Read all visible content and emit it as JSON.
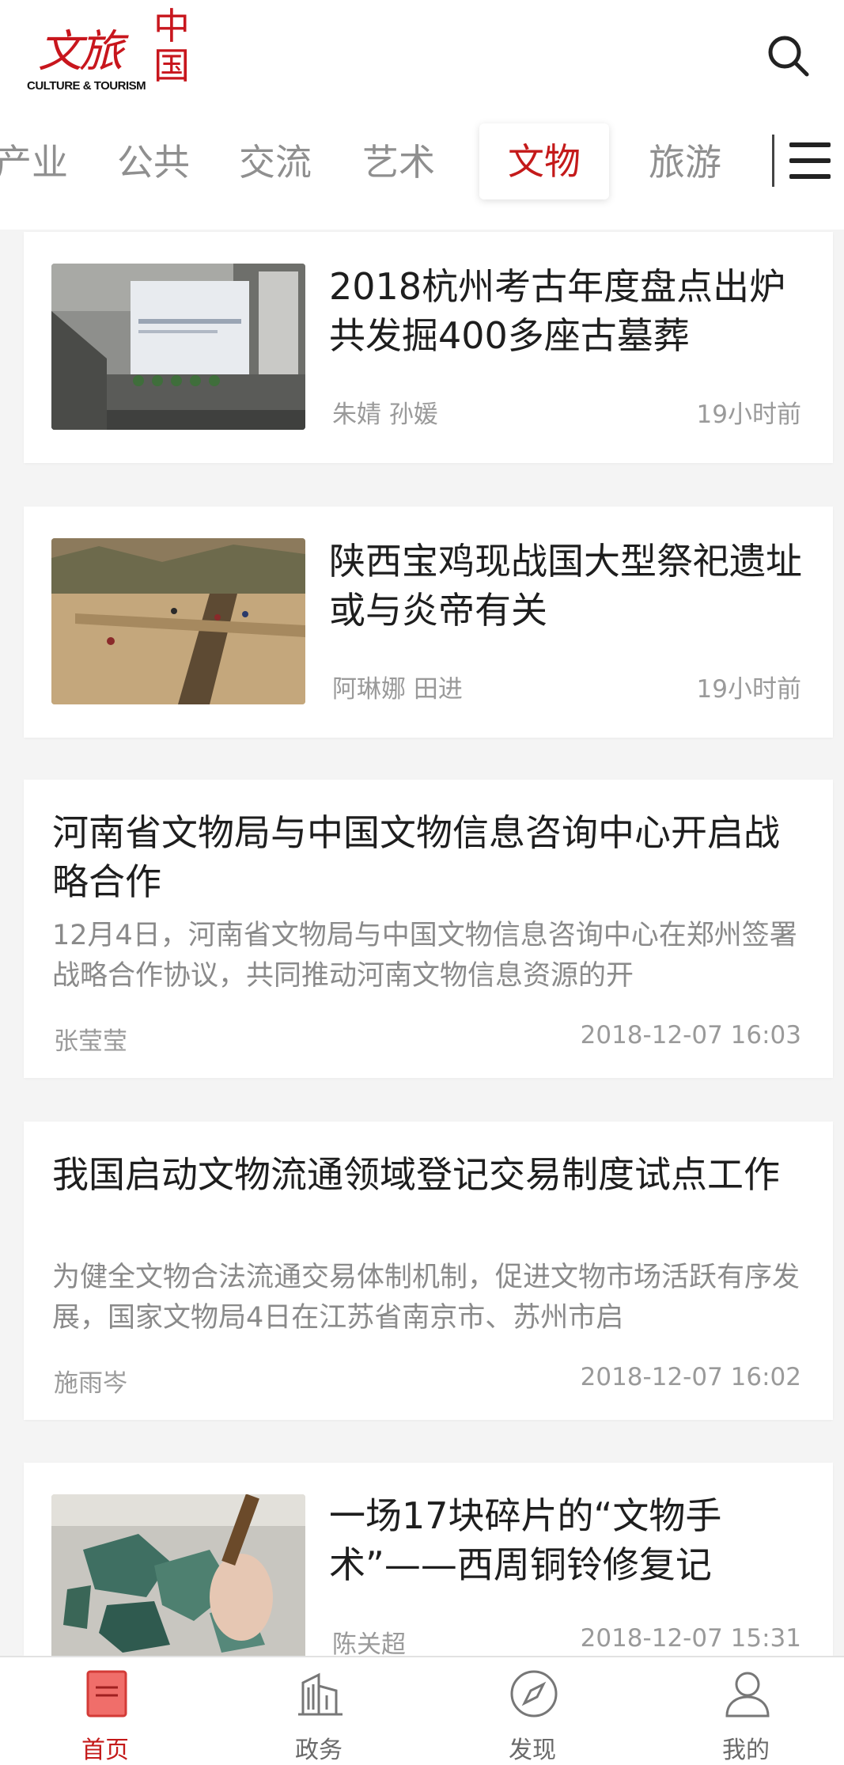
{
  "app": {
    "logo_cn": "文旅",
    "logo_cn_side": "中国",
    "logo_en": "CULTURE & TOURISM"
  },
  "tabs": [
    {
      "label": "产业"
    },
    {
      "label": "公共"
    },
    {
      "label": "交流"
    },
    {
      "label": "艺术"
    },
    {
      "label": "文物",
      "active": true
    },
    {
      "label": "旅游"
    }
  ],
  "articles": [
    {
      "title": "2018杭州考古年度盘点出炉共发掘400多座古墓葬",
      "author": "朱婧 孙媛",
      "time": "19小时前",
      "has_image": true
    },
    {
      "title": "陕西宝鸡现战国大型祭祀遗址  或与炎帝有关",
      "author": "阿琳娜 田进",
      "time": "19小时前",
      "has_image": true
    },
    {
      "title": "河南省文物局与中国文物信息咨询中心开启战略合作",
      "summary": "12月4日，河南省文物局与中国文物信息咨询中心在郑州签署战略合作协议，共同推动河南文物信息资源的开",
      "author": "张莹莹",
      "time": "2018-12-07 16:03",
      "has_image": false
    },
    {
      "title": "我国启动文物流通领域登记交易制度试点工作",
      "summary": "为健全文物合法流通交易体制机制，促进文物市场活跃有序发展，国家文物局4日在江苏省南京市、苏州市启",
      "author": "施雨岑",
      "time": "2018-12-07 16:02",
      "has_image": false
    },
    {
      "title": "一场17块碎片的“文物手术”——西周铜铃修复记",
      "author": "陈关超",
      "time": "2018-12-07 15:31",
      "has_image": true
    }
  ],
  "bottom_nav": [
    {
      "label": "首页",
      "icon": "home-icon",
      "active": true
    },
    {
      "label": "政务",
      "icon": "building-icon"
    },
    {
      "label": "发现",
      "icon": "compass-icon"
    },
    {
      "label": "我的",
      "icon": "user-icon"
    }
  ],
  "colors": {
    "accent": "#c41a1a",
    "background": "#f4f4f4",
    "meta_text": "#9a9a9a"
  }
}
